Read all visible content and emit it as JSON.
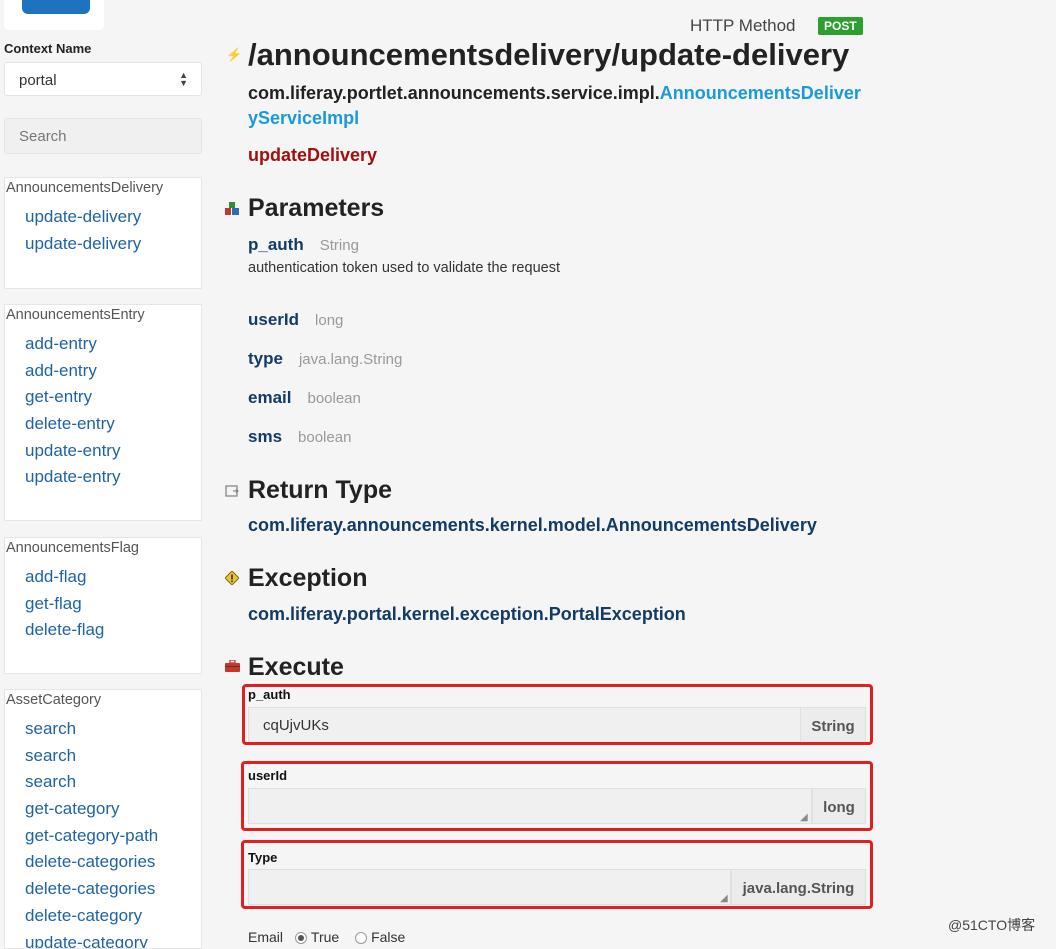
{
  "sidebar": {
    "context_label": "Context Name",
    "context_value": "portal",
    "search_placeholder": "Search",
    "panels": [
      {
        "title": "AnnouncementsDelivery",
        "items": [
          "update-delivery",
          "update-delivery"
        ]
      },
      {
        "title": "AnnouncementsEntry",
        "items": [
          "add-entry",
          "add-entry",
          "get-entry",
          "delete-entry",
          "update-entry",
          "update-entry"
        ]
      },
      {
        "title": "AnnouncementsFlag",
        "items": [
          "add-flag",
          "get-flag",
          "delete-flag"
        ]
      },
      {
        "title": "AssetCategory",
        "items": [
          "search",
          "search",
          "search",
          "get-category",
          "get-category-path",
          "delete-categories",
          "delete-categories",
          "delete-category",
          "update-category"
        ]
      }
    ]
  },
  "header": {
    "http_method_label": "HTTP Method",
    "http_method": "POST"
  },
  "main": {
    "endpoint": "/announcementsdelivery/update-delivery",
    "class_prefix": "com.liferay.portlet.announcements.service.impl.",
    "class_name": "AnnouncementsDeliveryServiceImpl",
    "method_name": "updateDelivery",
    "parameters_heading": "Parameters",
    "parameters": [
      {
        "name": "p_auth",
        "type": "String",
        "description": "authentication token used to validate the request"
      },
      {
        "name": "userId",
        "type": "long"
      },
      {
        "name": "type",
        "type": "java.lang.String"
      },
      {
        "name": "email",
        "type": "boolean"
      },
      {
        "name": "sms",
        "type": "boolean"
      }
    ],
    "return_heading": "Return Type",
    "return_type": "com.liferay.announcements.kernel.model.AnnouncementsDelivery",
    "exception_heading": "Exception",
    "exception_type": "com.liferay.portal.kernel.exception.PortalException",
    "execute_heading": "Execute",
    "execute": {
      "p_auth": {
        "label": "p_auth",
        "value": "cqUjvUKs",
        "type": "String"
      },
      "userId": {
        "label": "userId",
        "value": "",
        "type": "long"
      },
      "type": {
        "label": "Type",
        "value": "",
        "type": "java.lang.String"
      },
      "email": {
        "label": "Email",
        "true_label": "True",
        "false_label": "False",
        "selected": "True"
      }
    }
  },
  "colors": {
    "accent_link": "#1e63a6",
    "class_highlight": "#1a9bd7",
    "method": "#a10f0f",
    "post_badge": "#2ca02c",
    "annotation_box": "#e02020"
  },
  "watermark": "@51CTO博客"
}
